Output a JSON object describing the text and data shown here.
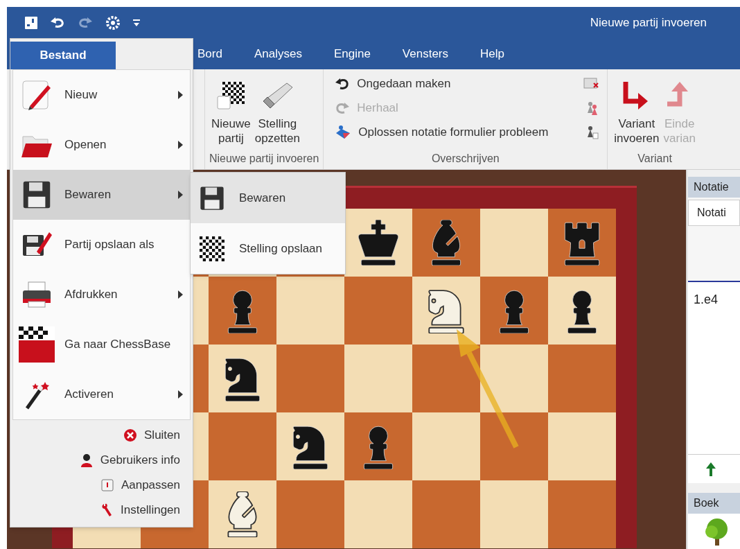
{
  "window": {
    "title": "Nieuwe partij invoeren"
  },
  "menu_tabs": [
    {
      "label": "Bord"
    },
    {
      "label": "Analyses"
    },
    {
      "label": "Engine"
    },
    {
      "label": "Vensters"
    },
    {
      "label": "Help"
    }
  ],
  "ribbon": {
    "groups": [
      {
        "title": "Nieuwe partij invoeren",
        "kind": "large",
        "buttons": [
          {
            "lines": [
              "Nieuwe",
              "partij"
            ],
            "disabled": false
          },
          {
            "lines": [
              "Stelling",
              "opzetten"
            ],
            "disabled": false
          }
        ]
      },
      {
        "title": "Overschrijven",
        "kind": "small",
        "buttons": [
          {
            "label": "Ongedaan maken",
            "disabled": false
          },
          {
            "label": "Herhaal",
            "disabled": true
          },
          {
            "label": "Oplossen notatie formulier probleem",
            "disabled": false
          }
        ]
      },
      {
        "title": "Variant",
        "kind": "large",
        "buttons": [
          {
            "lines": [
              "Variant",
              "invoeren"
            ],
            "disabled": false
          },
          {
            "lines": [
              "Einde",
              "varian"
            ],
            "disabled": true
          }
        ]
      }
    ]
  },
  "file_menu": {
    "tab": "Bestand",
    "items": [
      {
        "label": "Nieuw",
        "submenu": true,
        "selected": false
      },
      {
        "label": "Openen",
        "submenu": true,
        "selected": false
      },
      {
        "label": "Bewaren",
        "submenu": true,
        "selected": true
      },
      {
        "label": "Partij opslaan als",
        "submenu": false,
        "selected": false
      },
      {
        "label": "Afdrukken",
        "submenu": true,
        "selected": false
      },
      {
        "label": "Ga naar ChessBase",
        "submenu": false,
        "selected": false
      },
      {
        "label": "Activeren",
        "submenu": true,
        "selected": false
      }
    ],
    "footer": [
      "Sluiten",
      "Gebruikers info",
      "Aanpassen",
      "Instellingen"
    ]
  },
  "submenu": {
    "items": [
      {
        "label": "Bewaren",
        "selected": true
      },
      {
        "label": "Stelling opslaan",
        "selected": false
      }
    ]
  },
  "board": {
    "ranks": [
      [
        {
          "kind": "empty"
        },
        {
          "kind": "empty"
        },
        {
          "kind": "empty"
        },
        {
          "kind": "empty"
        },
        {
          "kind": "king",
          "white": false
        },
        {
          "kind": "bishop",
          "white": false
        },
        {
          "kind": "empty"
        },
        {
          "kind": "rook",
          "white": false
        }
      ],
      [
        {
          "kind": "empty"
        },
        {
          "kind": "empty"
        },
        {
          "kind": "pawn",
          "white": false
        },
        {
          "kind": "empty"
        },
        {
          "kind": "empty"
        },
        {
          "kind": "knight",
          "white": true
        },
        {
          "kind": "pawn",
          "white": false
        },
        {
          "kind": "pawn",
          "white": false
        }
      ],
      [
        {
          "kind": "empty"
        },
        {
          "kind": "empty"
        },
        {
          "kind": "knight",
          "white": false
        },
        {
          "kind": "empty"
        },
        {
          "kind": "empty"
        },
        {
          "kind": "empty"
        },
        {
          "kind": "empty"
        },
        {
          "kind": "empty"
        }
      ],
      [
        {
          "kind": "empty"
        },
        {
          "kind": "empty"
        },
        {
          "kind": "empty"
        },
        {
          "kind": "knight",
          "white": false
        },
        {
          "kind": "pawn",
          "white": false
        },
        {
          "kind": "empty"
        },
        {
          "kind": "empty"
        },
        {
          "kind": "empty"
        }
      ],
      [
        {
          "kind": "empty"
        },
        {
          "kind": "empty"
        },
        {
          "kind": "bishop",
          "white": true
        },
        {
          "kind": "empty"
        },
        {
          "kind": "empty"
        },
        {
          "kind": "empty"
        },
        {
          "kind": "empty"
        },
        {
          "kind": "empty"
        }
      ]
    ]
  },
  "notation_panel": {
    "title": "Notatie",
    "tab": "Notati",
    "moves": "1.e4"
  },
  "book_panel": {
    "title": "Boek"
  }
}
